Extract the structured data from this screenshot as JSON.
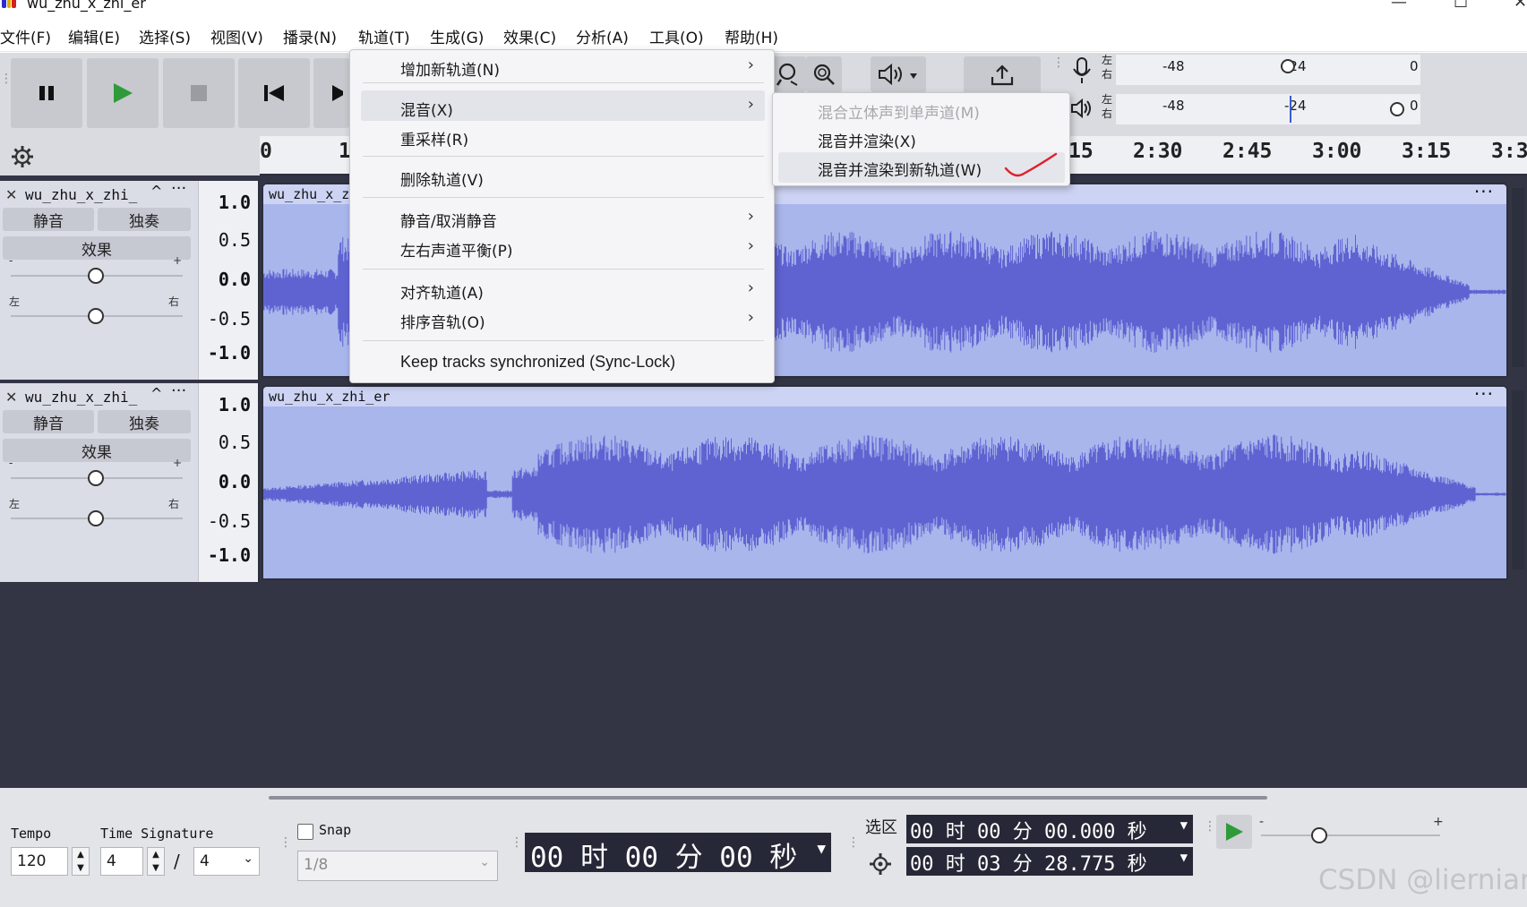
{
  "window": {
    "title": "wu_zhu_x_zhi_er"
  },
  "menubar": {
    "items": [
      "文件(F)",
      "编辑(E)",
      "选择(S)",
      "视图(V)",
      "播录(N)",
      "轨道(T)",
      "生成(G)",
      "效果(C)",
      "分析(A)",
      "工具(O)",
      "帮助(H)"
    ]
  },
  "meters": {
    "record": {
      "left": "左",
      "right": "右",
      "ticks": [
        "-48",
        "-24",
        "0"
      ]
    },
    "playback": {
      "left": "左",
      "right": "右",
      "ticks": [
        "-48",
        "-24",
        "0"
      ]
    }
  },
  "ruler": {
    "ticks": [
      "0",
      "1",
      "15",
      "2:30",
      "2:45",
      "3:00",
      "3:15",
      "3:3"
    ]
  },
  "track_menu": {
    "items": [
      {
        "label": "增加新轨道(N)",
        "submenu": true
      },
      {
        "label": "混音(X)",
        "submenu": true,
        "highlighted": true
      },
      {
        "label": "重采样(R)",
        "submenu": false
      },
      {
        "label": "删除轨道(V)",
        "submenu": false
      },
      {
        "label": "静音/取消静音",
        "submenu": true
      },
      {
        "label": "左右声道平衡(P)",
        "submenu": true
      },
      {
        "label": "对齐轨道(A)",
        "submenu": true
      },
      {
        "label": "排序音轨(O)",
        "submenu": true
      },
      {
        "label": "Keep tracks synchronized (Sync-Lock)",
        "submenu": false
      }
    ]
  },
  "mix_submenu": {
    "items": [
      {
        "label": "混合立体声到单声道(M)",
        "disabled": true
      },
      {
        "label": "混音并渲染(X)",
        "disabled": false
      },
      {
        "label": "混音并渲染到新轨道(W)",
        "disabled": false,
        "highlighted": true
      }
    ]
  },
  "tracks": [
    {
      "name": "wu_zhu_x_zhi_",
      "clip_name": "wu_zhu_x_z",
      "mute": "静音",
      "solo": "独奏",
      "effects": "效果",
      "gain_minus": "-",
      "gain_plus": "+",
      "pan_left": "左",
      "pan_right": "右",
      "scale": [
        "1.0",
        "0.5",
        "0.0",
        "-0.5",
        "-1.0"
      ]
    },
    {
      "name": "wu_zhu_x_zhi_",
      "clip_name": "wu_zhu_x_zhi_er",
      "mute": "静音",
      "solo": "独奏",
      "effects": "效果",
      "gain_minus": "-",
      "gain_plus": "+",
      "pan_left": "左",
      "pan_right": "右",
      "scale": [
        "1.0",
        "0.5",
        "0.0",
        "-0.5",
        "-1.0"
      ]
    }
  ],
  "bottom": {
    "tempo_label": "Tempo",
    "tempo_value": "120",
    "time_sig_label": "Time Signature",
    "time_sig_num": "4",
    "time_sig_slash": "/",
    "time_sig_den": "4",
    "snap_label": "Snap",
    "snap_value": "1/8",
    "time_display": "00 时 00 分 00 秒",
    "selection_label": "选区",
    "selection_start": "00 时 00 分 00.000 秒",
    "selection_end": "00 时 03 分 28.775 秒",
    "speed_minus": "-",
    "speed_plus": "+"
  },
  "watermark": "CSDN @liernian",
  "colors": {
    "waveform": "#5f63d2",
    "clip_bg": "#a9b6ec",
    "track_area": "#333545",
    "annotation": "#e0202a"
  }
}
